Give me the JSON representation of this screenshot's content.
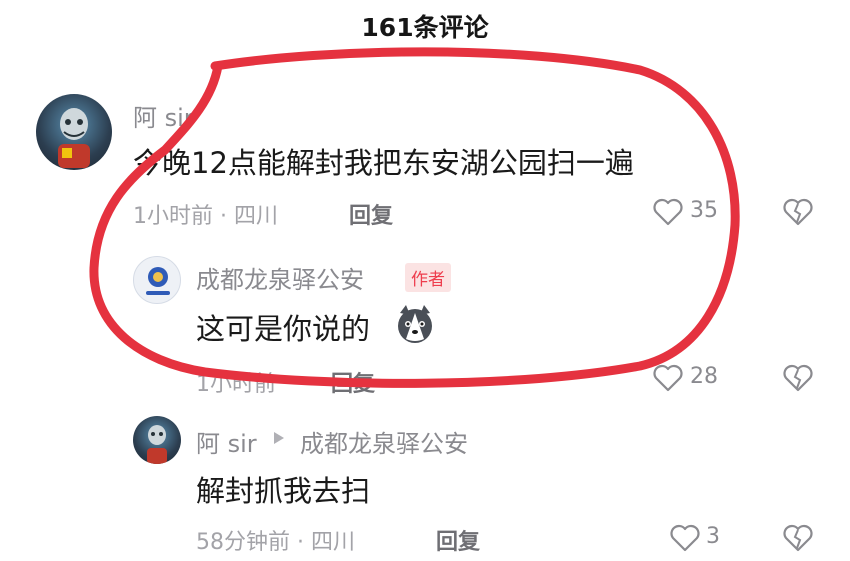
{
  "header": {
    "title": "161条评论"
  },
  "comments": [
    {
      "username": "阿 sir",
      "text": "今晚12点能解封我把东安湖公园扫一遍",
      "time": "1小时前 · 四川",
      "reply_label": "回复",
      "likes": "35",
      "reply": {
        "username": "成都龙泉驿公安",
        "badge": "作者",
        "text": "这可是你说的",
        "emoji": "husky-emoji",
        "time": "1小时前",
        "reply_label": "回复",
        "likes": "28"
      }
    },
    {
      "username": "阿 sir",
      "reply_to": "成都龙泉驿公安",
      "text": "解封抓我去扫",
      "time": "58分钟前 · 四川",
      "reply_label": "回复",
      "likes": "3"
    }
  ],
  "overlay": {
    "color": "#e5323f"
  },
  "icons": {
    "like": "heart-outline-icon",
    "dislike": "broken-heart-icon",
    "reply_arrow": "triangle-right-icon"
  }
}
